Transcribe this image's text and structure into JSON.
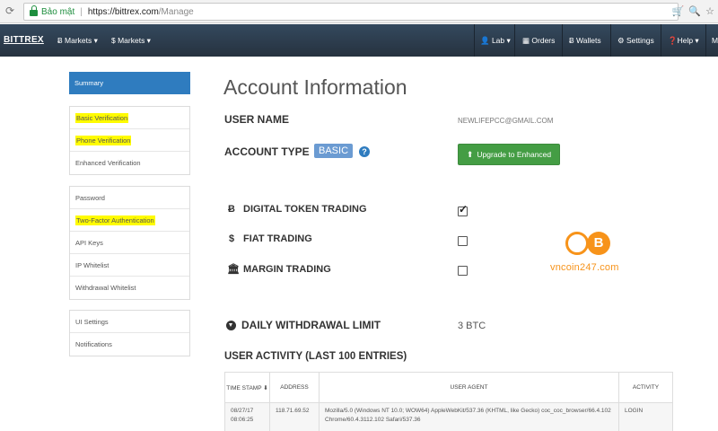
{
  "browser": {
    "secure_label": "Bảo mật",
    "separator": "|",
    "url_host": "https://bittrex.com",
    "url_path": "/Manage"
  },
  "nav": {
    "brand": "BITTREX",
    "items_left": [
      "Ƀ Markets ▾",
      "$ Markets ▾"
    ],
    "items_right": [
      "Lab ▾",
      "Orders",
      "Wallets",
      "Settings",
      "Help ▾",
      "M"
    ]
  },
  "sidebar": {
    "summary": "Summary",
    "verification": [
      "Basic Verification",
      "Phone Verification",
      "Enhanced Verification"
    ],
    "security": [
      "Password",
      "Two-Factor Authentication",
      "API Keys",
      "IP Whitelist",
      "Withdrawal Whitelist"
    ],
    "other": [
      "UI Settings",
      "Notifications"
    ]
  },
  "main": {
    "title": "Account Information",
    "user_name_label": "USER NAME",
    "user_name_value": "NEWLIFEPCC@GMAIL.COM",
    "account_type_label": "ACCOUNT TYPE",
    "account_type_badge": "BASIC",
    "upgrade_button": "Upgrade to Enhanced",
    "trading": [
      {
        "label": "DIGITAL TOKEN TRADING",
        "icon": "Ƀ",
        "checked": true
      },
      {
        "label": "FIAT TRADING",
        "icon": "$",
        "checked": false
      },
      {
        "label": "MARGIN TRADING",
        "icon": "🏛",
        "checked": false
      }
    ],
    "withdrawal_label": "DAILY WITHDRAWAL LIMIT",
    "withdrawal_value": "3 BTC",
    "activity_label": "USER ACTIVITY (LAST 100 ENTRIES)"
  },
  "activity_table": {
    "headers": [
      "TIME STAMP",
      "ADDRESS",
      "USER AGENT",
      "ACTIVITY"
    ],
    "rows": [
      {
        "time": "08/27/17 08:06:25",
        "address": "118.71.69.52",
        "agent": "Mozilla/5.0 (Windows NT 10.0; WOW64) AppleWebKit/537.36 (KHTML, like Gecko) coc_coc_browser/66.4.102 Chrome/60.4.3112.102 Safari/537.36",
        "activity": "LOGIN"
      }
    ]
  },
  "watermark": {
    "text": "vncoin247.com",
    "accent": "#f7931a"
  },
  "colors": {
    "nav_bg": "#2c3e50",
    "active_blue": "#2f7cbf",
    "upgrade_green": "#449d44",
    "highlight": "#fffb00"
  }
}
